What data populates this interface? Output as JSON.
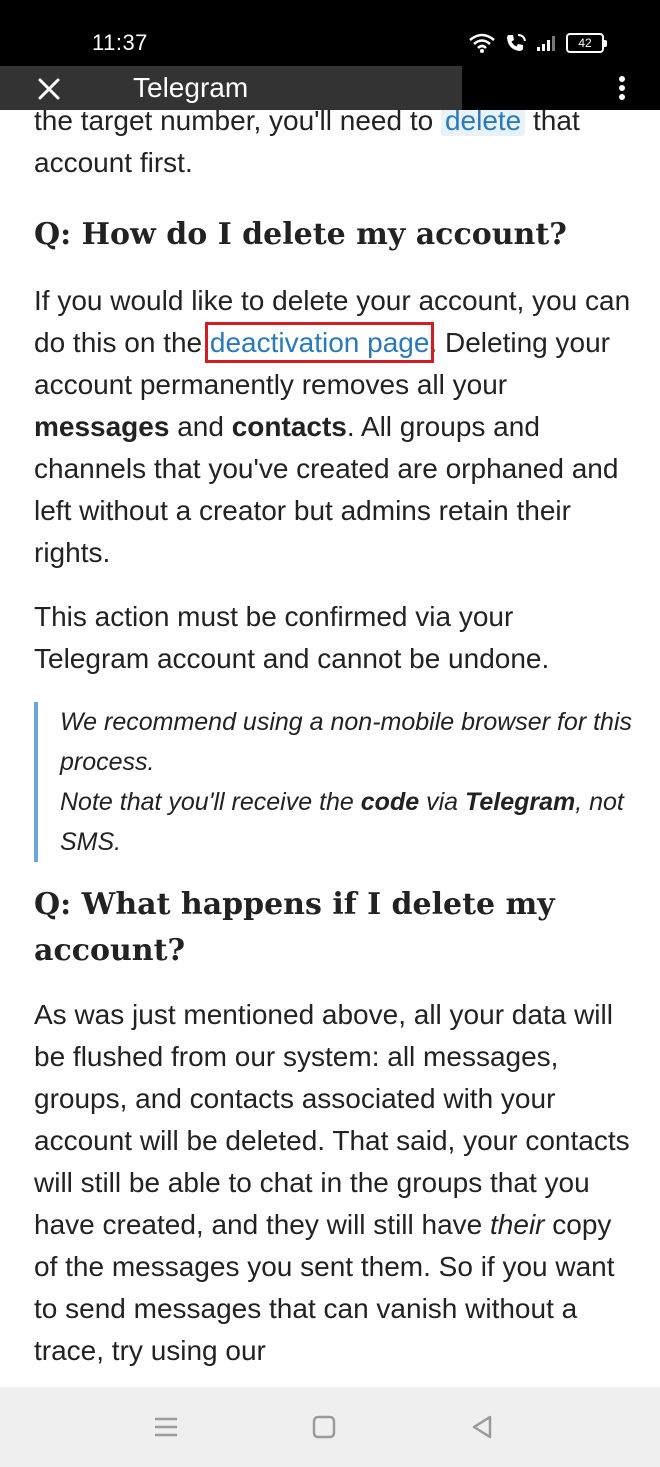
{
  "status_bar": {
    "time": "11:37",
    "battery": "42"
  },
  "header": {
    "title": "Telegram"
  },
  "content": {
    "p1": {
      "before": "the target number, you'll need to ",
      "link": "delete",
      "after": " that account first."
    },
    "q1": "Q: How do I delete my account?",
    "p2": {
      "before": "If you would like to delete your account, you can do this on the ",
      "link": "deactivation page",
      "after1": ". Deleting your account permanently removes all your ",
      "b1": "messages",
      "mid": " and ",
      "b2": "contacts",
      "after2": ". All groups and channels that you've created are orphaned and left without a creator but admins retain their rights."
    },
    "p3": "This action must be confirmed via your Telegram account and cannot be undone.",
    "note": {
      "line1": "We recommend using a non-mobile browser for this process.",
      "line2_before": "Note that you'll receive the ",
      "line2_b1": "code",
      "line2_mid": " via ",
      "line2_b2": "Telegram",
      "line2_after": ", not SMS."
    },
    "q2": "Q: What happens if I delete my account?",
    "p4": {
      "before": "As was just mentioned above, all your data will be flushed from our system: all messages, groups, and contacts associated with your account will be deleted. That said, your contacts will still be able to chat in the groups that you have created, and they will still have ",
      "em": "their",
      "after": " copy of the messages you sent them. So if you want to send messages that can vanish without a trace, try using our"
    }
  },
  "nav_bar": {
    "icons": [
      "recents-icon",
      "home-icon",
      "back-icon"
    ]
  }
}
